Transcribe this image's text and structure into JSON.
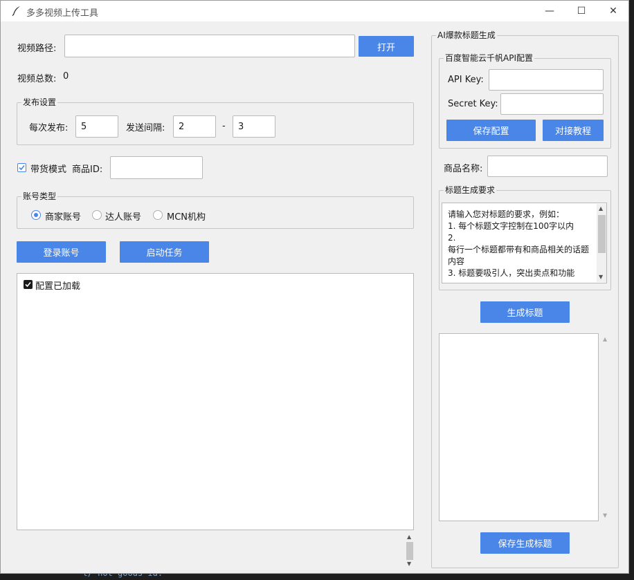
{
  "window": {
    "title": "多多视频上传工具",
    "minimize_glyph": "—",
    "maximize_glyph": "☐",
    "close_glyph": "✕"
  },
  "main": {
    "video_path_label": "视频路径:",
    "video_path_value": "",
    "open_button": "打开",
    "video_total_label": "视频总数:",
    "video_total_value": "0",
    "publish_settings": {
      "title": "发布设置",
      "per_publish_label": "每次发布:",
      "per_publish_value": "5",
      "interval_label": "发送间隔:",
      "interval_min": "2",
      "interval_sep": "-",
      "interval_max": "3"
    },
    "goods_mode_label": "带货模式",
    "goods_mode_checked": true,
    "goods_id_label": "商品ID:",
    "goods_id_value": "",
    "account_type": {
      "title": "账号类型",
      "options": [
        "商家账号",
        "达人账号",
        "MCN机构"
      ],
      "selected": 0
    },
    "login_button": "登录账号",
    "start_button": "启动任务",
    "log": {
      "config_loaded_label": "配置已加载",
      "config_loaded_checked": true
    }
  },
  "ai": {
    "title": "AI爆款标题生成",
    "api_group_title": "百度智能云千帆API配置",
    "api_key_label": "API Key:",
    "api_key_value": "",
    "secret_key_label": "Secret Key:",
    "secret_key_value": "",
    "save_config_button": "保存配置",
    "tutorial_button": "对接教程",
    "product_name_label": "商品名称:",
    "product_name_value": "",
    "requirement_group_title": "标题生成要求",
    "requirement_lines": [
      "请输入您对标题的要求，例如：",
      "1. 每个标题文字控制在100字以内",
      "2.",
      "每行一个标题都带有和商品相关的话题",
      "内容",
      "3. 标题要吸引人，突出卖点和功能"
    ],
    "generate_button": "生成标题",
    "save_generated_button": "保存生成标题"
  },
  "background_snippet": "t/'not goods id:"
}
